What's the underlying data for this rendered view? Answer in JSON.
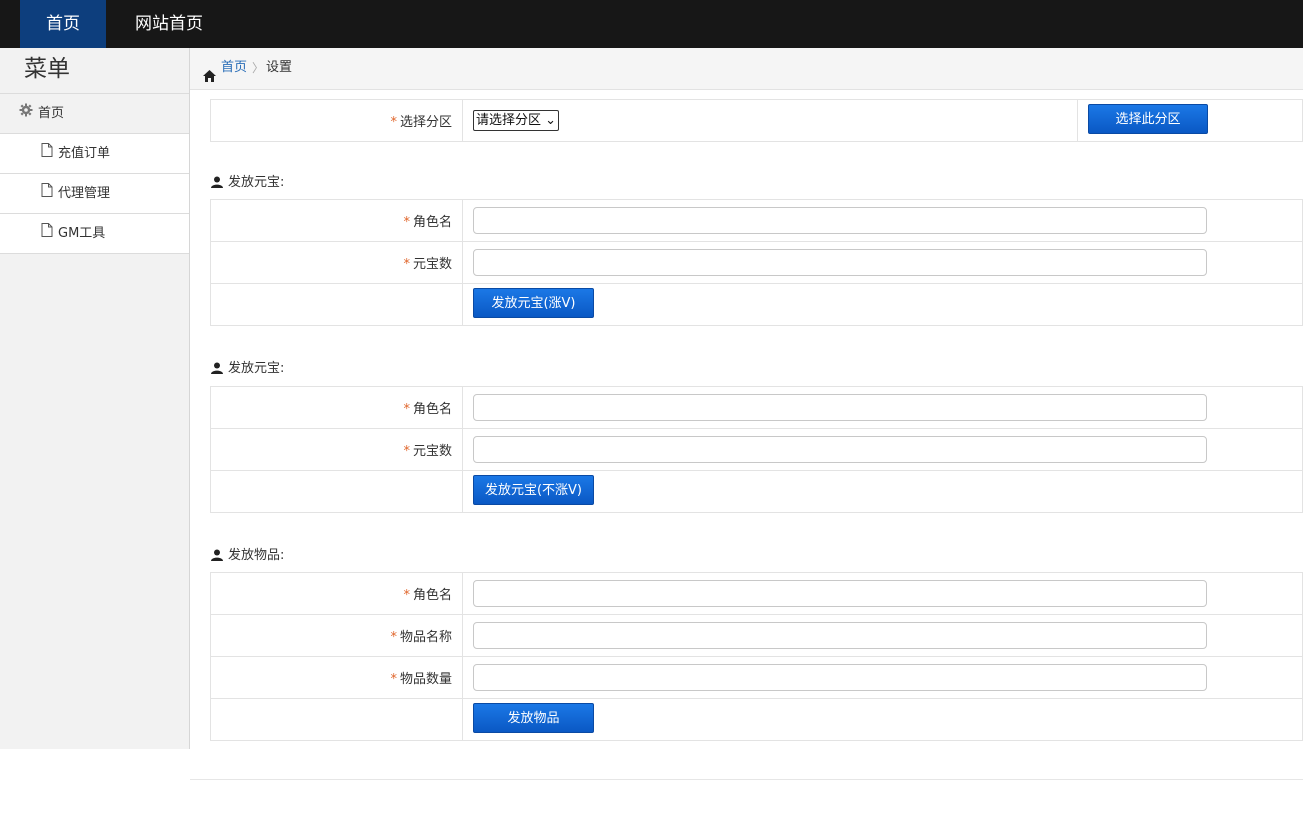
{
  "topnav": {
    "home": "首页",
    "site_home": "网站首页"
  },
  "sidebar": {
    "title": "菜单",
    "items": [
      {
        "label": "首页",
        "icon": "gear-icon"
      },
      {
        "label": "充值订单",
        "icon": "file-icon"
      },
      {
        "label": "代理管理",
        "icon": "file-icon"
      },
      {
        "label": "GM工具",
        "icon": "file-icon"
      }
    ]
  },
  "breadcrumb": {
    "home": "首页",
    "separator": "〉",
    "current": "设置"
  },
  "server_select": {
    "label": "选择分区",
    "select_value": "请选择分区",
    "button": "选择此分区"
  },
  "sections": [
    {
      "title": "发放元宝:",
      "fields": [
        {
          "label": "角色名",
          "value": ""
        },
        {
          "label": "元宝数",
          "value": ""
        }
      ],
      "button": "发放元宝(涨V)"
    },
    {
      "title": "发放元宝:",
      "fields": [
        {
          "label": "角色名",
          "value": ""
        },
        {
          "label": "元宝数",
          "value": ""
        }
      ],
      "button": "发放元宝(不涨V)"
    },
    {
      "title": "发放物品:",
      "fields": [
        {
          "label": "角色名",
          "value": ""
        },
        {
          "label": "物品名称",
          "value": ""
        },
        {
          "label": "物品数量",
          "value": ""
        }
      ],
      "button": "发放物品"
    }
  ],
  "colors": {
    "nav_bg": "#171717",
    "nav_active": "#0d3e7d",
    "button": "#0a58c4",
    "required": "#e0652a",
    "link": "#2a6eb8"
  }
}
